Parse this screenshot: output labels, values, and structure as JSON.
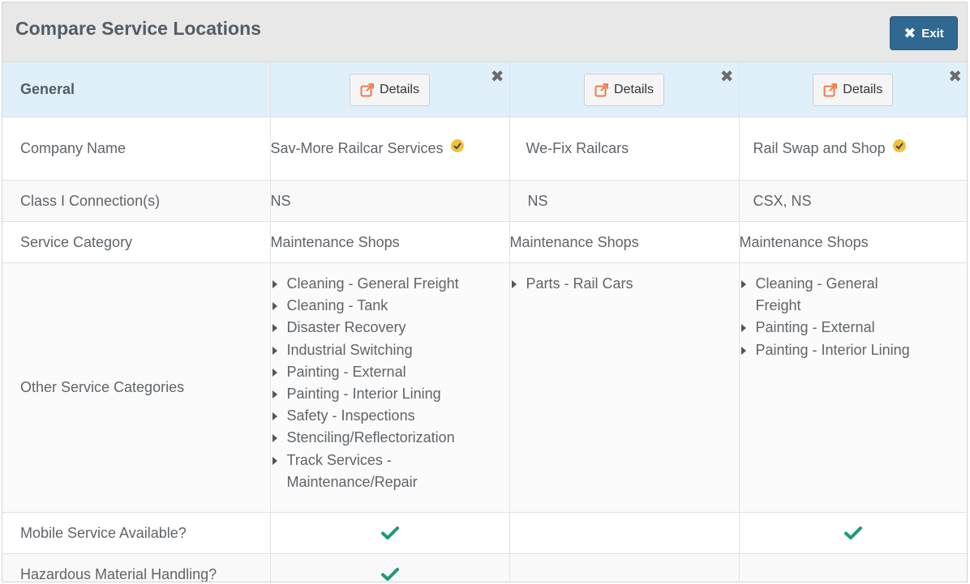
{
  "header": {
    "title": "Compare Service Locations",
    "exit_label": "Exit"
  },
  "general_label": "General",
  "details_label": "Details",
  "rows": {
    "company_name": "Company Name",
    "class1": "Class I Connection(s)",
    "service_category": "Service Category",
    "other_categories": "Other Service Categories",
    "mobile_service": "Mobile Service Available?",
    "hazmat": "Hazardous Material Handling?"
  },
  "locations": [
    {
      "company": "Sav-More Railcar Services",
      "verified": true,
      "class1": "NS",
      "service_category": "Maintenance Shops",
      "other": [
        "Cleaning - General Freight",
        "Cleaning - Tank",
        "Disaster Recovery",
        "Industrial Switching",
        "Painting - External",
        "Painting - Interior Lining",
        "Safety - Inspections",
        "Stenciling/Reflectorization",
        "Track Services - Maintenance/Repair"
      ],
      "mobile": true,
      "hazmat": true
    },
    {
      "company": "We-Fix Railcars",
      "verified": false,
      "class1": "NS",
      "service_category": "Maintenance Shops",
      "other": [
        "Parts - Rail Cars"
      ],
      "mobile": false,
      "hazmat": false
    },
    {
      "company": "Rail Swap and Shop",
      "verified": true,
      "class1": "CSX, NS",
      "service_category": "Maintenance Shops",
      "other": [
        "Cleaning - General Freight",
        "Painting - External",
        "Painting - Interior Lining"
      ],
      "mobile": true,
      "hazmat": false
    }
  ],
  "colors": {
    "header_bg": "#e8e8e8",
    "exit_bg": "#2f6890",
    "general_row_bg": "#dff0fb",
    "check_color": "#1c9a7a",
    "verified_badge": "#f0c23c",
    "external_link_icon": "#f07c4a"
  },
  "icons": {
    "exit": "times-icon",
    "details": "external-link-icon",
    "remove": "close-icon",
    "verified": "verified-badge-icon",
    "yes": "checkmark-icon",
    "list_bullet": "caret-right-icon"
  }
}
